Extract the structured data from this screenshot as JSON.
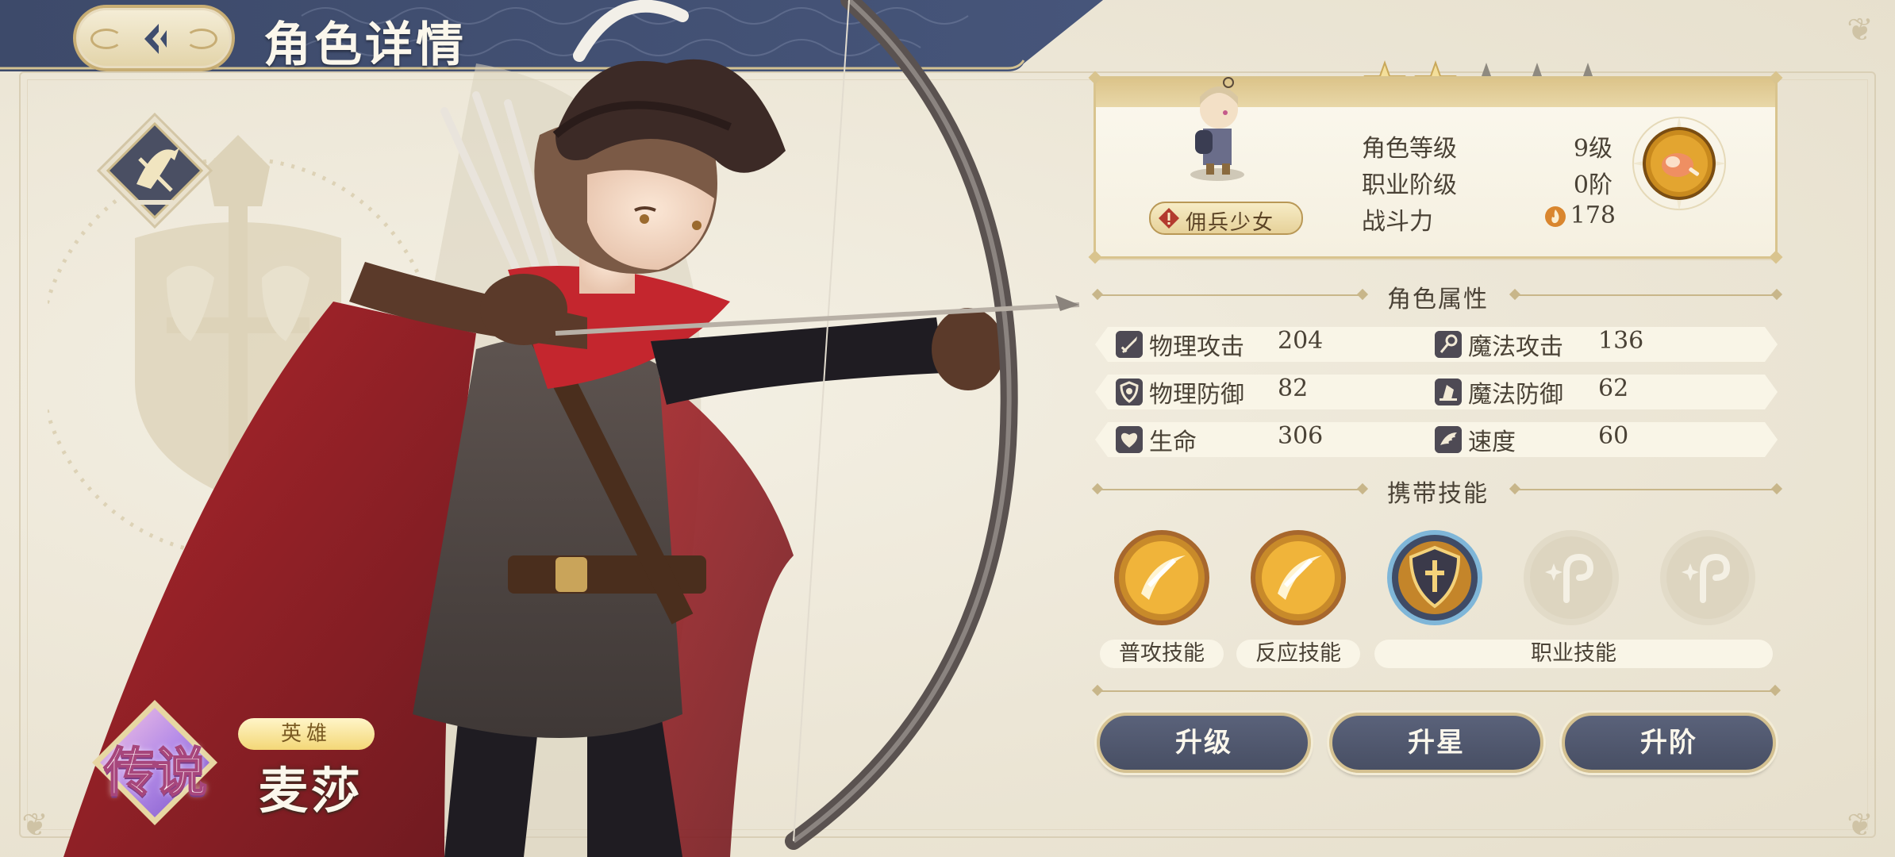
{
  "header": {
    "title": "角色详情",
    "back_icon": "back-arrow-icon"
  },
  "character": {
    "name": "麦莎",
    "rarity": "传说",
    "tier_tag": "英雄",
    "class_tag": "佣兵少女",
    "stars_filled": 2,
    "stars_total": 5
  },
  "info": {
    "level_label": "角色等级",
    "level_value": "9级",
    "rank_label": "职业阶级",
    "rank_value": "0阶",
    "power_label": "战斗力",
    "power_value": "178"
  },
  "attributes": {
    "title": "角色属性",
    "items": [
      {
        "label": "物理攻击",
        "value": "204",
        "icon": "sword-icon"
      },
      {
        "label": "魔法攻击",
        "value": "136",
        "icon": "wand-icon"
      },
      {
        "label": "物理防御",
        "value": "82",
        "icon": "shield-icon"
      },
      {
        "label": "魔法防御",
        "value": "62",
        "icon": "wizard-hat-icon"
      },
      {
        "label": "生命",
        "value": "306",
        "icon": "heart-icon"
      },
      {
        "label": "速度",
        "value": "60",
        "icon": "wing-icon"
      }
    ]
  },
  "skills": {
    "title": "携带技能",
    "normal_label": "普攻技能",
    "reaction_label": "反应技能",
    "class_label": "职业技能"
  },
  "actions": {
    "upgrade": "升级",
    "star_up": "升星",
    "rank_up": "升阶"
  },
  "colors": {
    "header_navy": "#3f4d6e",
    "gold": "#d9c48e",
    "button_slate": "#505870",
    "panel_cream": "#f8f4e6"
  }
}
